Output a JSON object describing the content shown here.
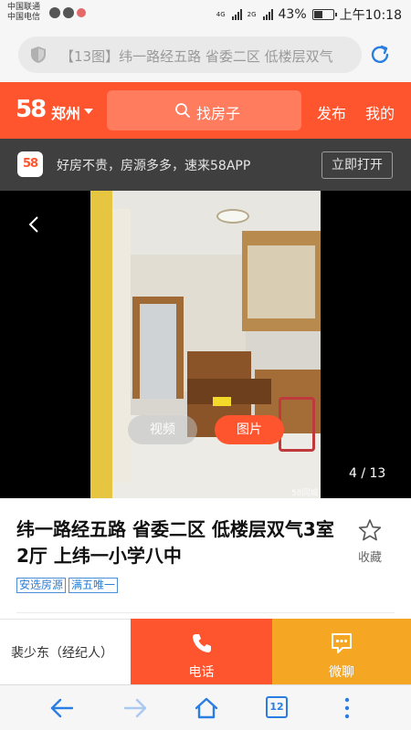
{
  "status_bar": {
    "carrier_1": "中国联通",
    "carrier_2": "中国电信",
    "net_1": "4G",
    "net_2": "2G",
    "battery_text": "43%",
    "battery_level": 0.43,
    "time": "上午10:18"
  },
  "browser": {
    "url_text": "【13图】纬一路经五路 省委二区 低楼层双气",
    "tab_count": "12",
    "icons": [
      "shield-icon",
      "reload-icon",
      "back-icon",
      "forward-icon",
      "home-icon",
      "tabs-icon",
      "more-icon"
    ]
  },
  "header": {
    "logo": "58",
    "city": "郑州",
    "search_label": "找房子",
    "publish_label": "发布",
    "mine_label": "我的"
  },
  "app_banner": {
    "logo": "58",
    "text": "好房不贵，房源多多，速来58APP",
    "open_label": "立即打开"
  },
  "gallery": {
    "video_label": "视频",
    "photo_label": "图片",
    "counter": "4 / 13",
    "watermark": "58同城"
  },
  "listing": {
    "title": "纬一路经五路 省委二区 低楼层双气3室2厅 上纬一小学八中",
    "favorite_label": "收藏",
    "tags": [
      "安选房源",
      "满五唯一"
    ]
  },
  "actions": {
    "agent": "裴少东（经纪人）",
    "call_label": "电话",
    "chat_label": "微聊"
  },
  "colors": {
    "brand": "#ff552e",
    "chat": "#f5a623",
    "browser_accent": "#2a7de1",
    "tag": "#2f7dd1"
  }
}
